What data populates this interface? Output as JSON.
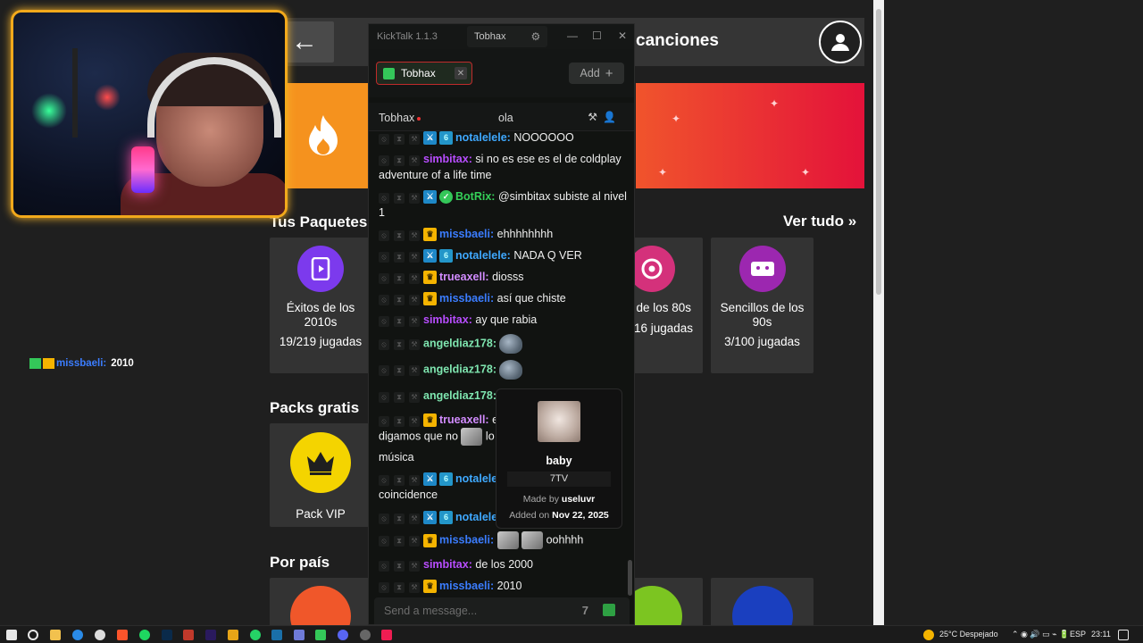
{
  "site": {
    "header_title": "canciones",
    "sections": {
      "packages": "Tus Paquetes",
      "view_all": "Ver tudo »",
      "free_packs": "Packs gratis",
      "by_country": "Por país"
    },
    "cards": [
      {
        "title": "Éxitos de los 2010s",
        "plays": "19/219 jugadas",
        "color": "#7c3aed"
      },
      {
        "title": "s de los 80s",
        "plays": "16 jugadas",
        "color": "#d4317b"
      },
      {
        "title": "Sencillos de los 90s",
        "plays": "3/100 jugadas",
        "color": "#9c27b0"
      }
    ],
    "vip_pack": {
      "title": "Pack VIP"
    }
  },
  "stream_overlay": {
    "chat_user": "missbaeli:",
    "chat_text": "2010"
  },
  "kicktalk": {
    "app_name": "KickTalk 1.1.3",
    "account_name": "Tobhax",
    "tab_name": "Tobhax",
    "add_label": "Add",
    "channel_name": "Tobhax",
    "stream_title": "ola",
    "input_placeholder": "Send a message...",
    "messages": [
      {
        "user": "notalelele:",
        "text": "NOOOOOO",
        "color": "#3fa9ff"
      },
      {
        "user": "simbitax:",
        "text": "si no es ese es el de coldplay adventure of a life time",
        "color": "#b84dff"
      },
      {
        "user": "BotRix:",
        "text": "@simbitax subiste al nivel 1",
        "color": "#34d058"
      },
      {
        "user": "missbaeli:",
        "text": "ehhhhhhhh",
        "color": "#3b7dff"
      },
      {
        "user": "notalelele:",
        "text": "NADA Q VER",
        "color": "#3fa9ff"
      },
      {
        "user": "trueaxell:",
        "text": "diosss",
        "color": "#d28cff"
      },
      {
        "user": "missbaeli:",
        "text": "así que chiste",
        "color": "#3b7dff"
      },
      {
        "user": "simbitax:",
        "text": "ay que rabia",
        "color": "#b84dff"
      },
      {
        "user": "angeldiaz178:",
        "text": "",
        "color": "#7fe6b0"
      },
      {
        "user": "angeldiaz178:",
        "text": "",
        "color": "#7fe6b0"
      },
      {
        "user": "angeldiaz178:",
        "text": "",
        "color": "#7fe6b0"
      },
      {
        "user": "trueaxell:",
        "text": "e",
        "color": "#d28cff"
      },
      {
        "user": "",
        "text": "digamos que no",
        "color": "#f0f0f0"
      },
      {
        "user": "",
        "text": "lo",
        "color": "#f0f0f0"
      },
      {
        "user": "",
        "text": "música",
        "color": "#f0f0f0"
      },
      {
        "user": "notalele",
        "text": "",
        "color": "#3fa9ff"
      },
      {
        "user": "",
        "text": "coincidence",
        "color": "#f0f0f0"
      },
      {
        "user": "notalele",
        "text": "",
        "color": "#3fa9ff"
      },
      {
        "user": "missbaeli:",
        "text": "oohhhh",
        "color": "#3b7dff"
      },
      {
        "user": "simbitax:",
        "text": "de los 2000",
        "color": "#b84dff"
      },
      {
        "user": "missbaeli:",
        "text": "2010",
        "color": "#3b7dff"
      }
    ],
    "tooltip": {
      "emote_name": "baby",
      "provider": "7TV",
      "made_by_label": "Made by",
      "made_by": "useluvr",
      "added_label": "Added on",
      "added_on": "Nov 22, 2025"
    }
  },
  "taskbar": {
    "weather": "25°C Despejado",
    "language": "ESP",
    "time": "23:11"
  }
}
